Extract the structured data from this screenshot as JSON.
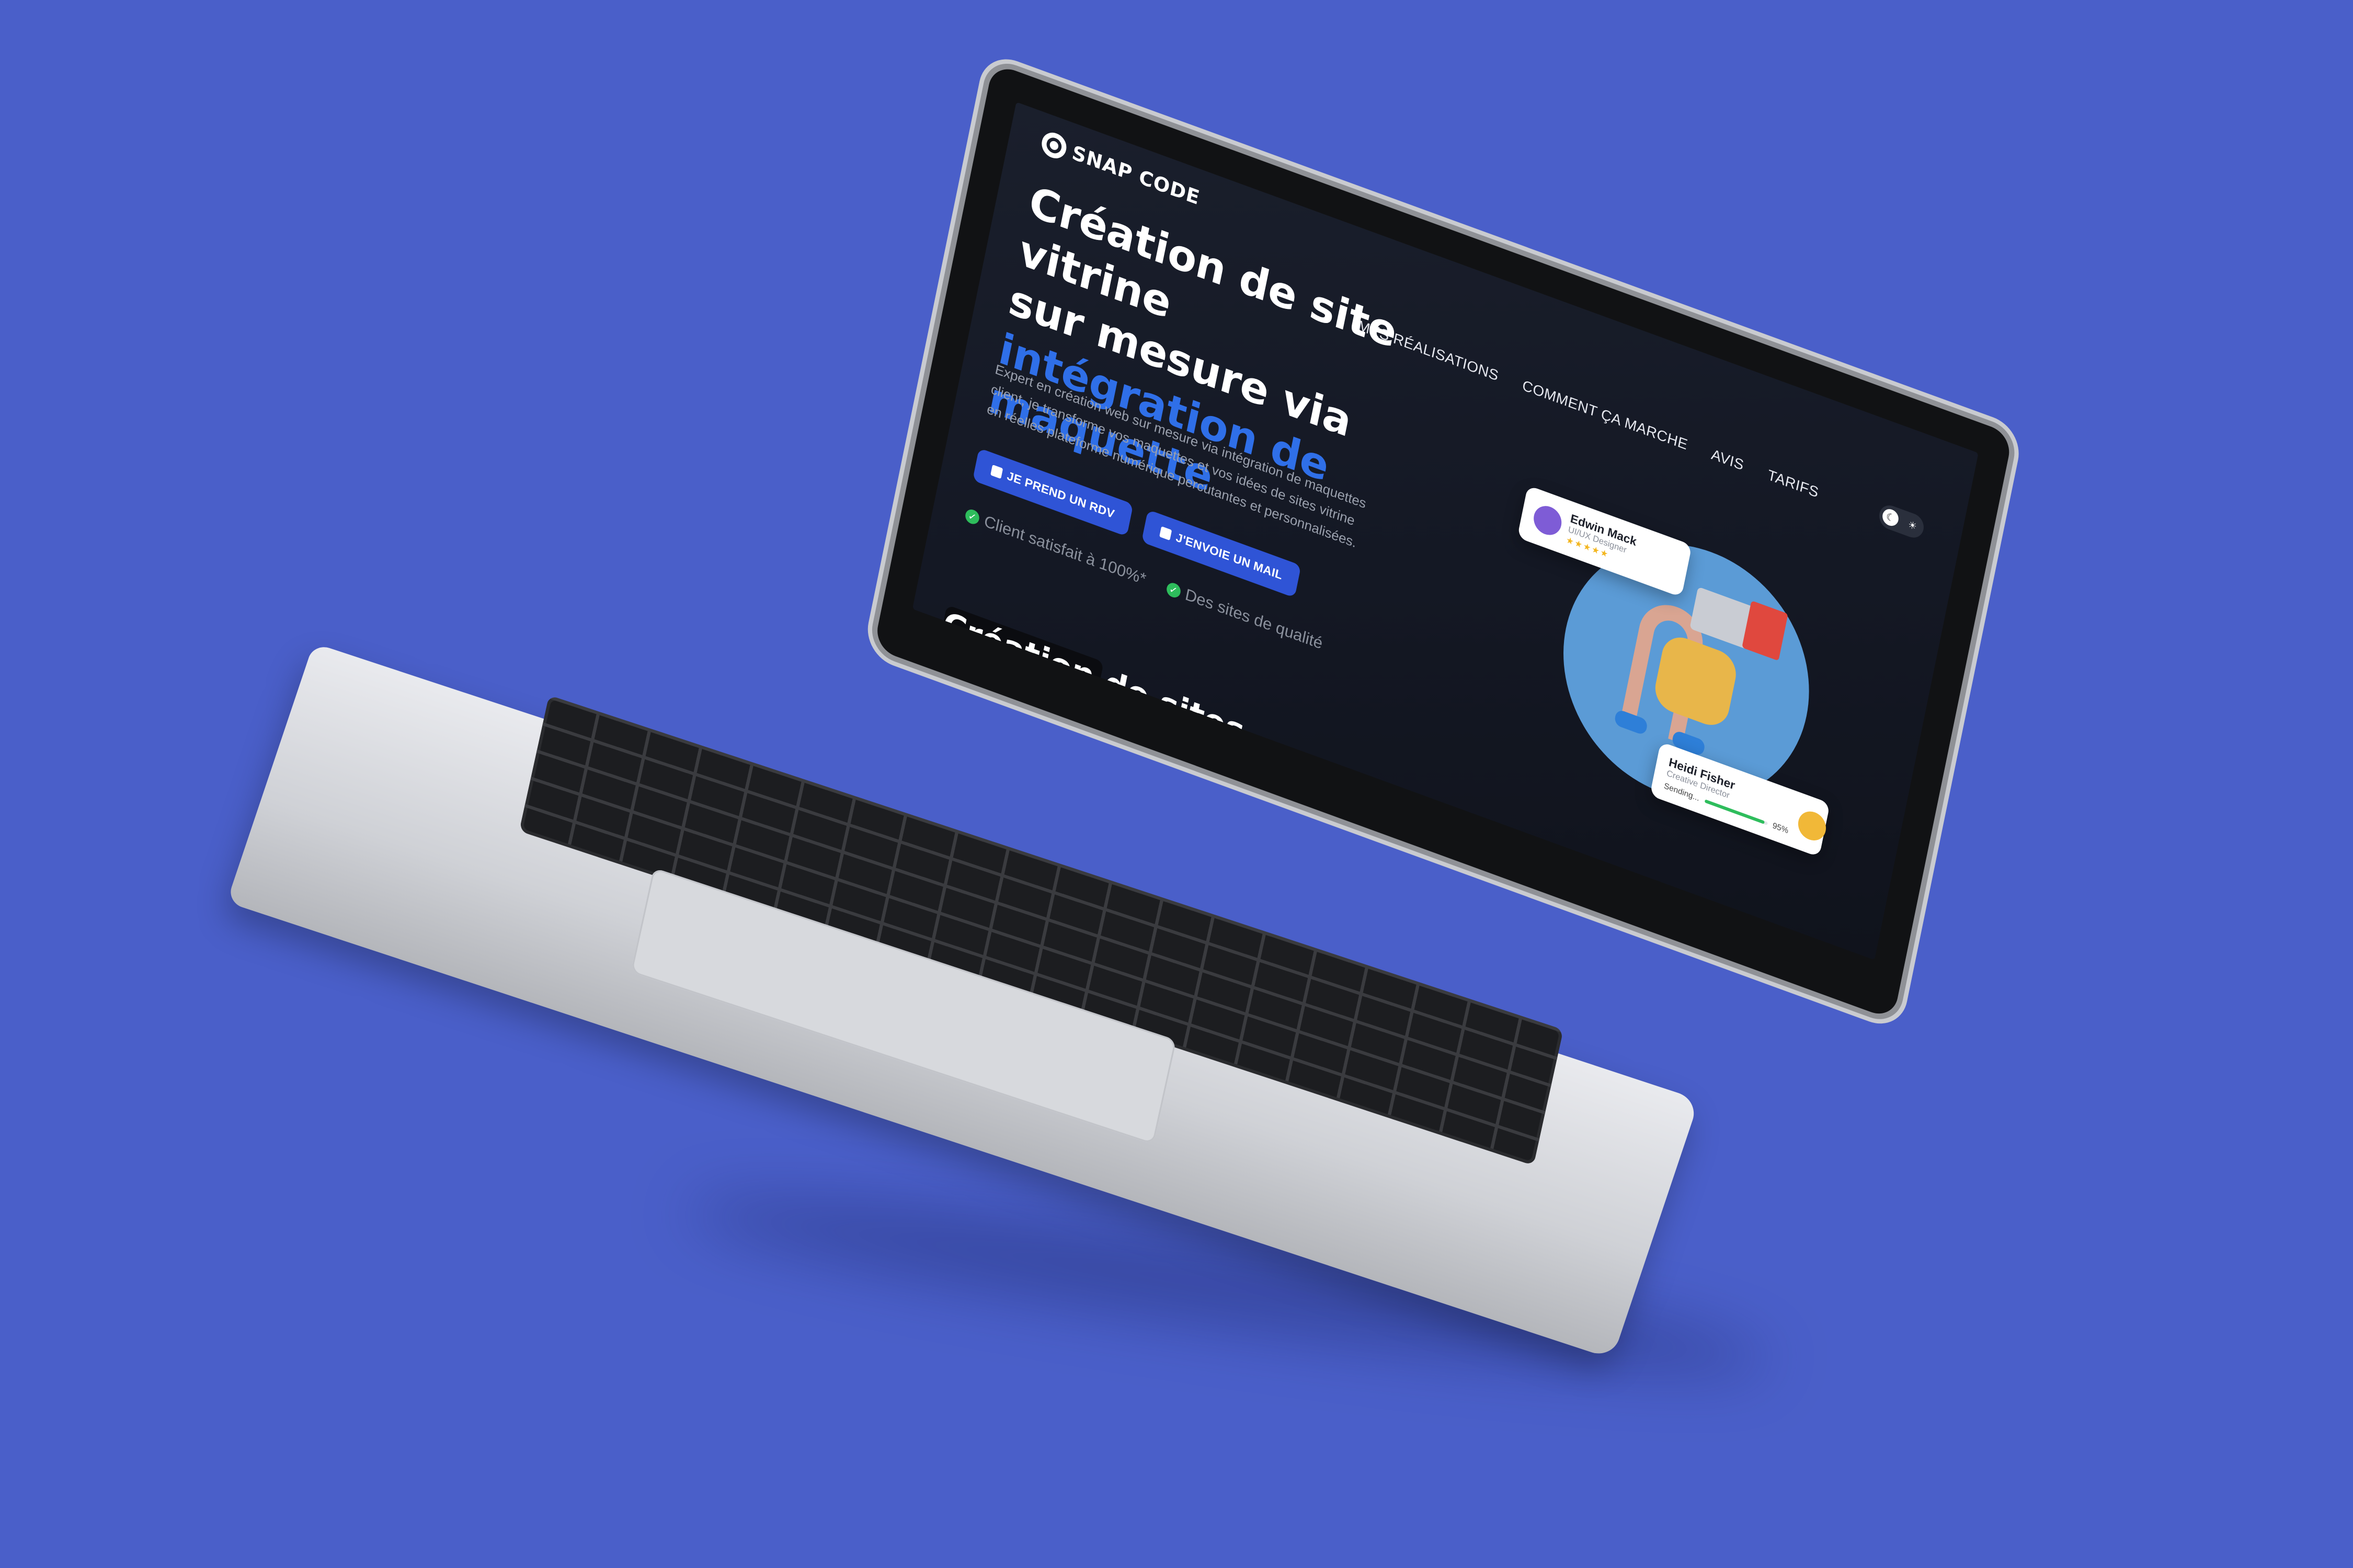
{
  "site": {
    "logo": "SNAP CODE",
    "nav": [
      "MES RÉALISATIONS",
      "COMMENT ÇA MARCHE",
      "AVIS",
      "TARIFS"
    ],
    "theme_toggle": {
      "dark_icon": "moon-icon",
      "light_icon": "sun-icon"
    }
  },
  "hero": {
    "title_line1": "Création de site vitrine",
    "title_line2": "sur mesure via",
    "title_accent": "intégration de maquette",
    "description": "Expert en création web sur mesure via intégration de maquettes client, je transforme vos maquettes et vos idées de sites vitrine en réelles plateforme numérique percutantes et personnalisées.",
    "buttons": [
      {
        "label": "JE PREND UN RDV",
        "icon": "calendar-icon"
      },
      {
        "label": "J'ENVOIE UN MAIL",
        "icon": "mail-icon"
      }
    ],
    "checks": [
      "Client satisfait à 100%*",
      "Des sites de qualité"
    ],
    "accent_color": "#2f6fe8"
  },
  "illustration": {
    "card1": {
      "name": "Edwin Mack",
      "role": "UI/UX Designer",
      "stars": "★★★★★"
    },
    "card2": {
      "name": "Heidi Fisher",
      "role": "Creative Director",
      "status": "Sending...",
      "progress_label": "95%",
      "progress": 0.95
    }
  },
  "section": {
    "title": "Création de sites"
  }
}
